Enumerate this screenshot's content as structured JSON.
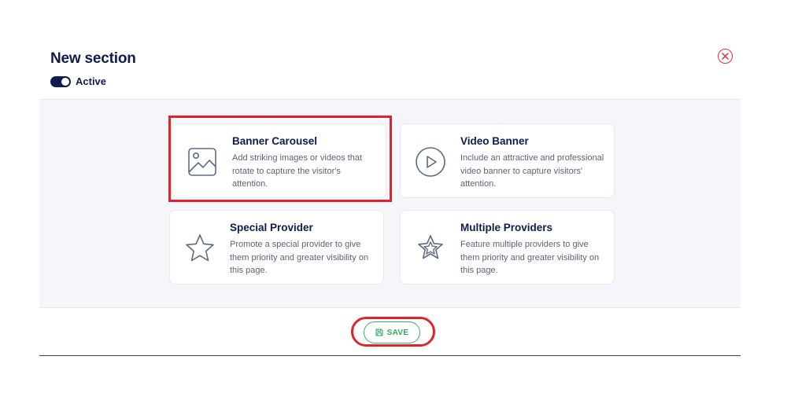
{
  "header": {
    "title": "New section",
    "active_label": "Active",
    "active_on": true
  },
  "cards": [
    {
      "icon": "image-icon",
      "title": "Banner Carousel",
      "description": "Add striking images or videos that rotate to capture the visitor's attention."
    },
    {
      "icon": "play-circle-icon",
      "title": "Video Banner",
      "description": "Include an attractive and professional video banner to capture visitors' attention."
    },
    {
      "icon": "star-icon",
      "title": "Special Provider",
      "description": "Promote a special provider to give them priority and greater visibility on this page."
    },
    {
      "icon": "stars-icon",
      "title": "Multiple Providers",
      "description": "Feature multiple providers to give them priority and greater visibility on this page."
    }
  ],
  "footer": {
    "save_label": "SAVE"
  },
  "colors": {
    "primary": "#0f1c4d",
    "accent_red": "#e0222c",
    "save_green": "#2fa960",
    "panel_bg": "#f4f6f9"
  }
}
